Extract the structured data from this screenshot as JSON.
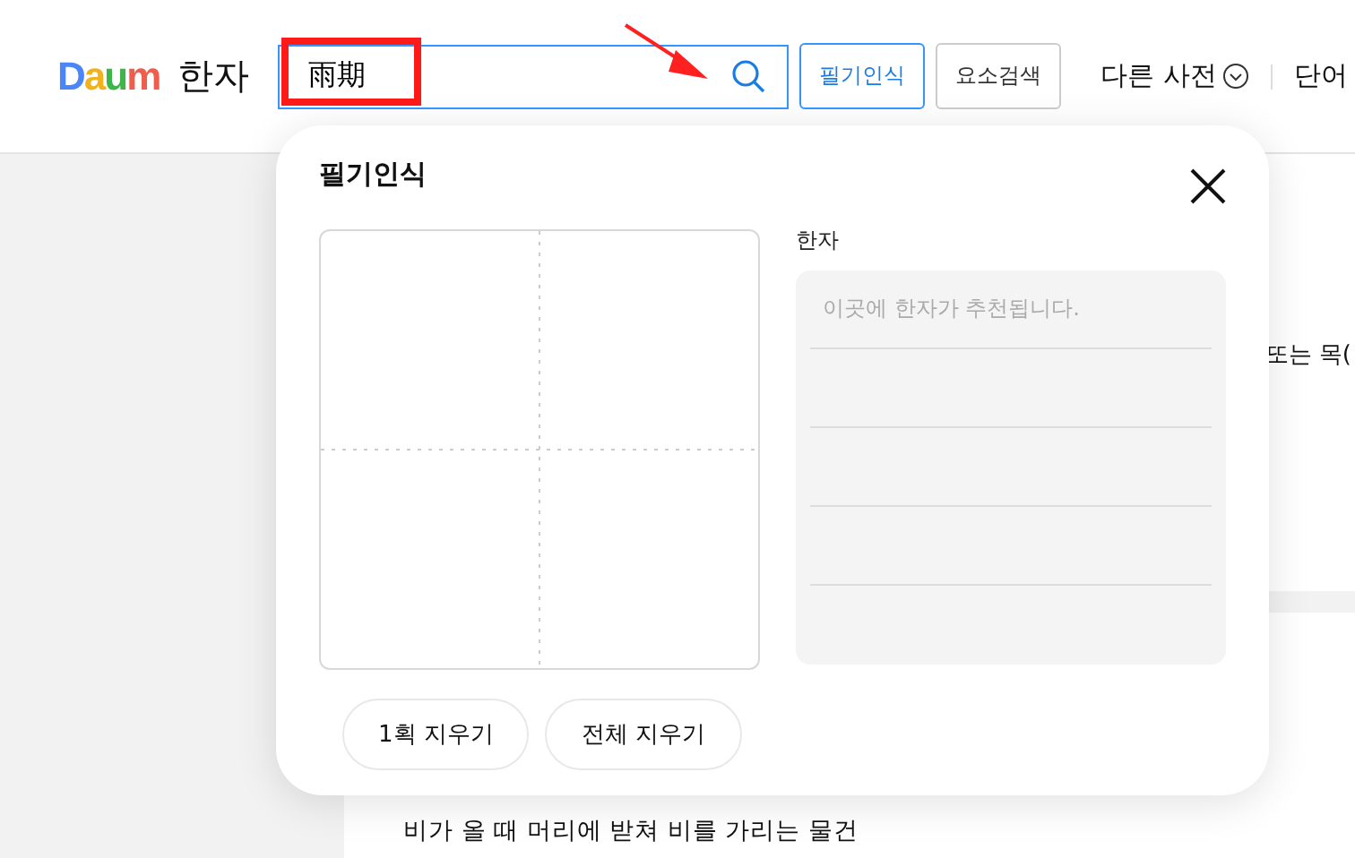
{
  "header": {
    "logo": "Daum",
    "section": "한자",
    "search": {
      "value": "雨期"
    },
    "buttons": [
      {
        "label": "필기인식",
        "selected": true
      },
      {
        "label": "요소검색",
        "selected": false
      }
    ],
    "other_dictionaries": "다른 사전",
    "next_menu": "단어"
  },
  "background": {
    "snippet": "또는 목(",
    "definition": "비가 올 때 머리에 받쳐 비를 가리는 물건"
  },
  "popup": {
    "title": "필기인식",
    "result_label": "한자",
    "result_placeholder": "이곳에 한자가 추천됩니다.",
    "buttons": [
      "1획 지우기",
      "전체 지우기"
    ]
  }
}
